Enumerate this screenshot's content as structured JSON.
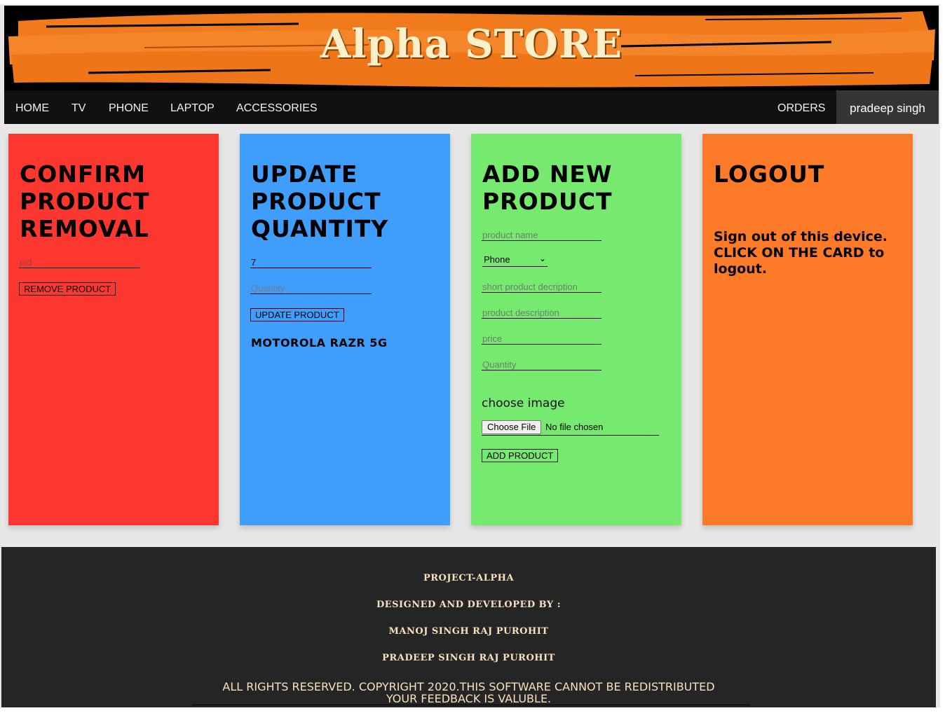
{
  "brand": {
    "title": "Alpha STORE"
  },
  "nav": {
    "items": [
      "HOME",
      "TV",
      "PHONE",
      "LAPTOP",
      "ACCESSORIES"
    ],
    "orders": "ORDERS",
    "user": "pradeep singh"
  },
  "cards": {
    "remove": {
      "title_lines": [
        "CONFIRM",
        "PRODUCT",
        "REMOVAL"
      ],
      "pid_placeholder": "pid",
      "button": "REMOVE PRODUCT",
      "color": "#fb3730"
    },
    "update": {
      "title_lines": [
        "UPDATE",
        "PRODUCT",
        "QUANTITY"
      ],
      "id_value": "7",
      "quantity_placeholder": "Quantity",
      "button": "UPDATE PRODUCT",
      "product_name": "MOTOROLA RAZR 5G",
      "color": "#3f9dfc"
    },
    "add": {
      "title_lines": [
        "ADD NEW",
        "PRODUCT"
      ],
      "name_placeholder": "product name",
      "category_selected": "Phone",
      "short_desc_placeholder": "short product decription",
      "desc_placeholder": "product description",
      "price_placeholder": "price",
      "quantity_placeholder": "Quantity",
      "choose_image_label": "choose image",
      "file_button": "Choose File",
      "file_status": "No file chosen",
      "button": "ADD PRODUCT",
      "color": "#76e96f"
    },
    "logout": {
      "title": "LOGOUT",
      "text": "Sign out of this device. CLICK ON THE CARD to logout.",
      "color": "#fd7a28"
    }
  },
  "footer": {
    "project": "PROJECT-ALPHA",
    "designed_by": "DESIGNED AND DEVELOPED BY :",
    "dev1": "MANOJ SINGH RAJ PUROHIT",
    "dev2": "PRADEEP SINGH RAJ PUROHIT",
    "rights": "ALL RIGHTS RESERVED. COPYRIGHT 2020.THIS SOFTWARE CANNOT BE REDISTRIBUTED",
    "feedback": "YOUR FEEDBACK IS VALUBLE."
  }
}
